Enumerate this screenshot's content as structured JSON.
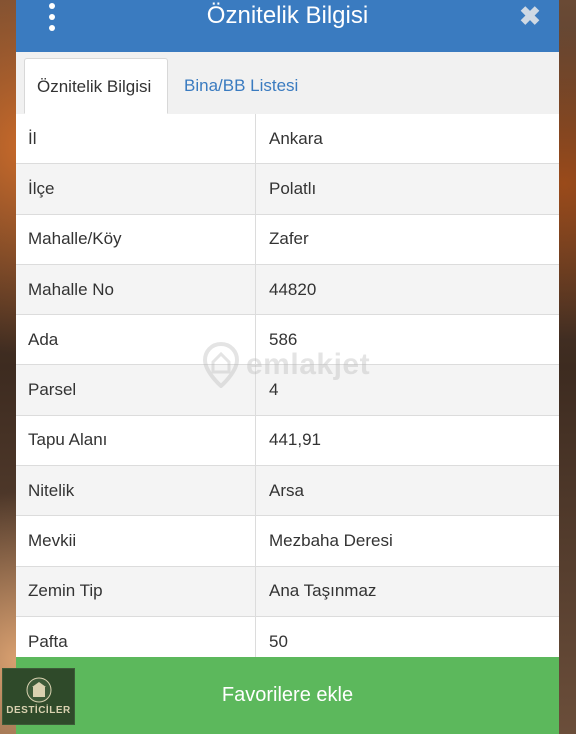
{
  "header": {
    "title": "Öznitelik Bilgisi"
  },
  "tabs": [
    {
      "label": "Öznitelik Bilgisi",
      "active": true
    },
    {
      "label": "Bina/BB Listesi",
      "active": false
    }
  ],
  "attributes": [
    {
      "label": "İl",
      "value": "Ankara"
    },
    {
      "label": "İlçe",
      "value": "Polatlı"
    },
    {
      "label": "Mahalle/Köy",
      "value": "Zafer"
    },
    {
      "label": "Mahalle No",
      "value": "44820"
    },
    {
      "label": "Ada",
      "value": "586"
    },
    {
      "label": "Parsel",
      "value": "4"
    },
    {
      "label": "Tapu Alanı",
      "value": "441,91"
    },
    {
      "label": "Nitelik",
      "value": "Arsa"
    },
    {
      "label": "Mevkii",
      "value": "Mezbaha Deresi"
    },
    {
      "label": "Zemin Tip",
      "value": "Ana Taşınmaz"
    },
    {
      "label": "Pafta",
      "value": "50"
    }
  ],
  "watermark": {
    "text": "emlakjet"
  },
  "footer": {
    "button_label": "Favorilere ekle"
  },
  "logo": {
    "text": "DESTİCİLER"
  },
  "colors": {
    "header": "#3a7bc0",
    "footer": "#5cb85c",
    "tab_link": "#3a7bc0"
  },
  "icons": [
    "menu-icon",
    "close-icon",
    "location-pin-icon"
  ]
}
